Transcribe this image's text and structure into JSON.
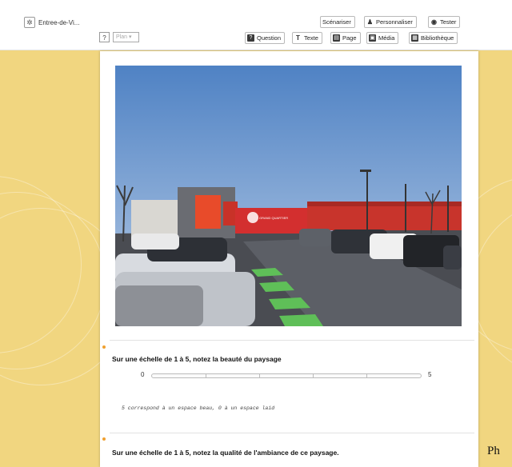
{
  "toolbar": {
    "project_title": "Entree-de-Vi...",
    "help_label": "?",
    "plan_select": "Plan",
    "buttons_top": {
      "scenariser": "Scénariser",
      "personnaliser": "Personnaliser",
      "tester": "Tester"
    },
    "buttons_bottom": {
      "question": "Question",
      "texte": "Texte",
      "page": "Page",
      "media": "Média",
      "bibliotheque": "Bibliothèque"
    }
  },
  "questions": [
    {
      "text": "Sur une échelle de 1 à 5, notez la beauté du paysage",
      "min_label": "0",
      "max_label": "5",
      "note": "5 correspond à un espace beau, 0 à un espace laid"
    },
    {
      "text": "Sur une échelle de 1 à 5, notez la qualité de l'ambiance de ce paysage."
    }
  ],
  "photo_sign": "GRAND QUARTIER",
  "overflow_text": "Ph",
  "colors": {
    "accent": "#f0a030",
    "background": "#f1d680"
  }
}
